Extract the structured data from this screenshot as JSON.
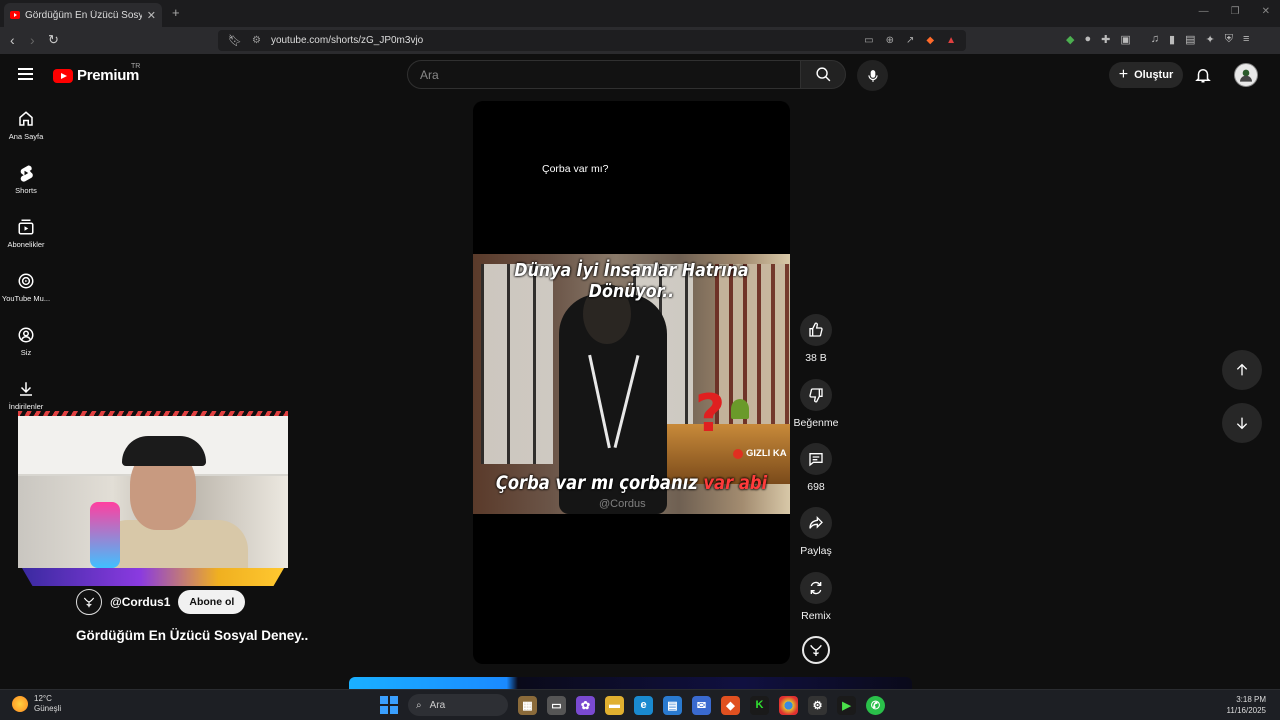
{
  "browser": {
    "tab_title": "Gördüğüm En Üzücü Sosyal Deney..",
    "url": "youtube.com/shorts/zG_JP0m3vjo"
  },
  "header": {
    "logo_text": "Premium",
    "country": "TR",
    "search_placeholder": "Ara",
    "create_label": "Oluştur"
  },
  "sidebar": {
    "items": [
      {
        "label": "Ana Sayfa",
        "icon": "home-icon"
      },
      {
        "label": "Shorts",
        "icon": "shorts-icon"
      },
      {
        "label": "Abonelikler",
        "icon": "subscriptions-icon"
      },
      {
        "label": "YouTube Mu...",
        "icon": "youtube-music-icon"
      },
      {
        "label": "Siz",
        "icon": "user-icon"
      },
      {
        "label": "İndirilenler",
        "icon": "download-icon"
      }
    ]
  },
  "short": {
    "top_caption": "Çorba var mı?",
    "frame_caption_top": "Dünya İyi İnsanlar Hatrına Dönüyor..",
    "frame_caption_bottom_a": "Çorba var mı çorbanız ",
    "frame_caption_bottom_b": "var abi",
    "frame_badge": "GIZLI KA",
    "frame_watermark": "@Cordus"
  },
  "actions": {
    "like_count": "38 B",
    "dislike_label": "Beğenme",
    "comment_count": "698",
    "share_label": "Paylaş",
    "remix_label": "Remix"
  },
  "channel": {
    "handle": "@Cordus1",
    "subscribe_label": "Abone ol",
    "video_title": "Gördüğüm En Üzücü Sosyal Deney.."
  },
  "taskbar": {
    "temperature": "12°C",
    "weather_text": "Güneşli",
    "search_label": "Ara",
    "time": "3:18 PM",
    "date": "11/16/2025"
  }
}
